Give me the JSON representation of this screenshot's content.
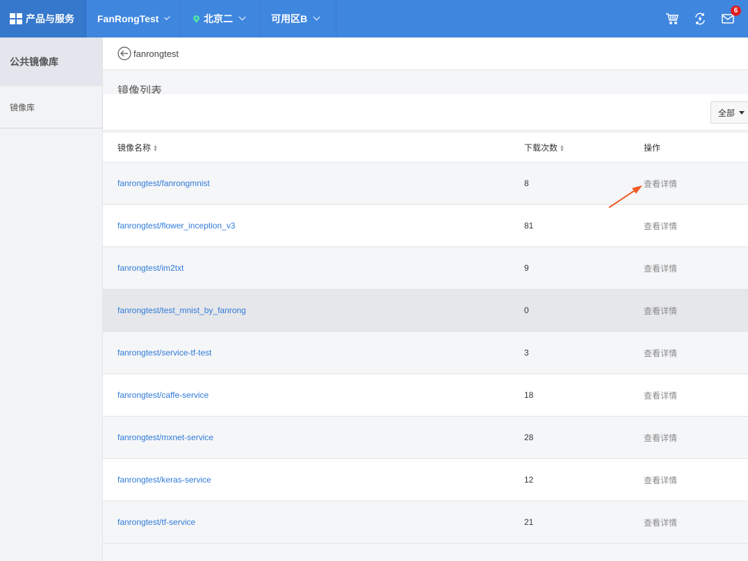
{
  "topbar": {
    "products_label": "产品与服务",
    "project": "FanRongTest",
    "region": "北京二",
    "zone": "可用区B",
    "notification_count": "6"
  },
  "sidebar": {
    "title": "公共镜像库",
    "items": [
      {
        "label": "镜像库"
      }
    ]
  },
  "main": {
    "back_label": "fanrongtest",
    "section_title": "镜像列表",
    "filter_value": "全部",
    "columns": {
      "name": "镜像名称",
      "downloads": "下载次数",
      "actions": "操作"
    },
    "rows": [
      {
        "name": "fanrongtest/fanrongmnist",
        "downloads": "8",
        "action": "查看详情"
      },
      {
        "name": "fanrongtest/flower_inception_v3",
        "downloads": "81",
        "action": "查看详情"
      },
      {
        "name": "fanrongtest/im2txt",
        "downloads": "9",
        "action": "查看详情"
      },
      {
        "name": "fanrongtest/test_mnist_by_fanrong",
        "downloads": "0",
        "action": "查看详情"
      },
      {
        "name": "fanrongtest/service-tf-test",
        "downloads": "3",
        "action": "查看详情"
      },
      {
        "name": "fanrongtest/caffe-service",
        "downloads": "18",
        "action": "查看详情"
      },
      {
        "name": "fanrongtest/mxnet-service",
        "downloads": "28",
        "action": "查看详情"
      },
      {
        "name": "fanrongtest/keras-service",
        "downloads": "12",
        "action": "查看详情"
      },
      {
        "name": "fanrongtest/tf-service",
        "downloads": "21",
        "action": "查看详情"
      }
    ]
  },
  "colors": {
    "topbar": "#3f86df",
    "link": "#2f7ad8",
    "badge": "#e02020",
    "annotation_arrow": "#f05a23"
  }
}
